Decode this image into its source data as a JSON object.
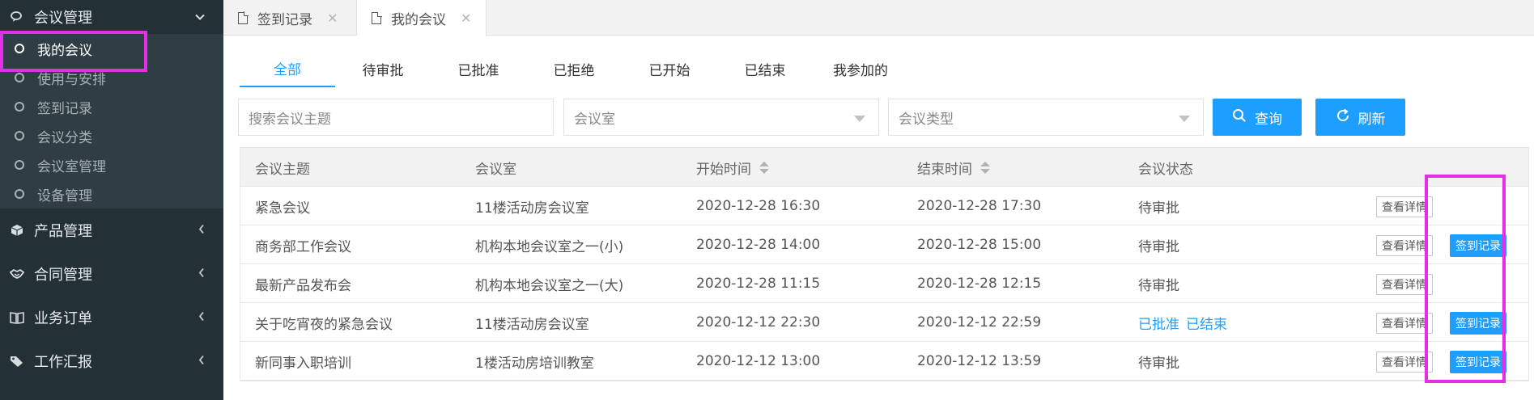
{
  "sidebar": {
    "groups": [
      {
        "label": "会议管理",
        "icon": "chat-icon"
      },
      {
        "label": "产品管理",
        "icon": "cube-icon"
      },
      {
        "label": "合同管理",
        "icon": "handshake-icon"
      },
      {
        "label": "业务订单",
        "icon": "book-icon"
      },
      {
        "label": "工作汇报",
        "icon": "tag-icon"
      }
    ],
    "meeting_items": [
      {
        "label": "我的会议"
      },
      {
        "label": "使用与安排"
      },
      {
        "label": "签到记录"
      },
      {
        "label": "会议分类"
      },
      {
        "label": "会议室管理"
      },
      {
        "label": "设备管理"
      }
    ]
  },
  "tabs": [
    {
      "label": "签到记录"
    },
    {
      "label": "我的会议"
    }
  ],
  "filter_tabs": [
    "全部",
    "待审批",
    "已批准",
    "已拒绝",
    "已开始",
    "已结束",
    "我参加的"
  ],
  "search": {
    "topic_placeholder": "搜索会议主题",
    "room_placeholder": "会议室",
    "type_placeholder": "会议类型",
    "query_label": "查询",
    "refresh_label": "刷新"
  },
  "table": {
    "headers": [
      "会议主题",
      "会议室",
      "开始时间",
      "结束时间",
      "会议状态"
    ],
    "detail_label": "查看详情",
    "sign_label": "签到记录",
    "rows": [
      {
        "topic": "紧急会议",
        "room": "11楼活动房会议室",
        "start": "2020-12-28 16:30",
        "end": "2020-12-28 17:30",
        "status": "待审批"
      },
      {
        "topic": "商务部工作会议",
        "room": "机构本地会议室之一(小)",
        "start": "2020-12-28 14:00",
        "end": "2020-12-28 15:00",
        "status": "待审批"
      },
      {
        "topic": "最新产品发布会",
        "room": "机构本地会议室之一(大)",
        "start": "2020-12-28 11:15",
        "end": "2020-12-28 12:15",
        "status": "待审批"
      },
      {
        "topic": "关于吃宵夜的紧急会议",
        "room": "11楼活动房会议室",
        "start": "2020-12-12 22:30",
        "end": "2020-12-12 22:59",
        "status_a": "已批准",
        "status_b": "已结束"
      },
      {
        "topic": "新同事入职培训",
        "room": "1楼活动房培训教室",
        "start": "2020-12-12 13:00",
        "end": "2020-12-12 13:59",
        "status": "待审批"
      }
    ]
  },
  "colors": {
    "accent": "#1e9fff",
    "sidebar_bg": "#233036",
    "highlight": "#e52ee5"
  }
}
